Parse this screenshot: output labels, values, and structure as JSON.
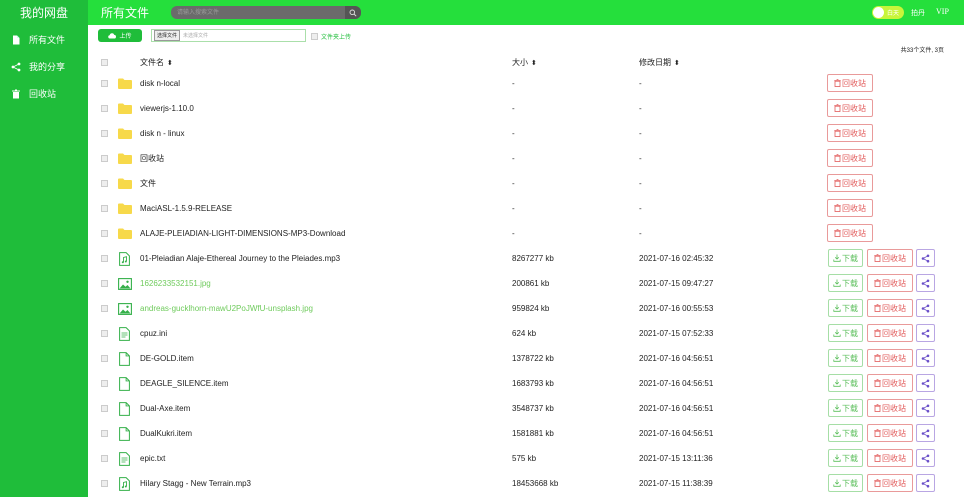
{
  "sidebar": {
    "brand": "我的网盘",
    "items": [
      {
        "label": "所有文件",
        "icon": "file-icon"
      },
      {
        "label": "我的分享",
        "icon": "share-icon"
      },
      {
        "label": "回收站",
        "icon": "trash-icon"
      }
    ]
  },
  "header": {
    "title": "所有文件",
    "search_placeholder": "请输入搜索文件",
    "toggle_label": "白天",
    "link_1": "拍丹",
    "link_2": "VIP"
  },
  "toolbar": {
    "upload_label": "上传",
    "choose_file": "选择文件",
    "no_file": "未选择文件",
    "folder_upload": "文件夹上传",
    "summary": "共33个文件, 3页"
  },
  "table": {
    "col_name": "文件名",
    "col_size": "大小",
    "col_date": "修改日期",
    "action_download": "下载",
    "action_recycle": "回收站",
    "rows": [
      {
        "name": "disk n-local",
        "type": "folder",
        "size": "-",
        "date": "-"
      },
      {
        "name": "viewerjs-1.10.0",
        "type": "folder",
        "size": "-",
        "date": "-"
      },
      {
        "name": "disk n - linux",
        "type": "folder",
        "size": "-",
        "date": "-"
      },
      {
        "name": "回收站",
        "type": "folder",
        "size": "-",
        "date": "-"
      },
      {
        "name": "文件",
        "type": "folder",
        "size": "-",
        "date": "-"
      },
      {
        "name": "MaciASL-1.5.9-RELEASE",
        "type": "folder",
        "size": "-",
        "date": "-"
      },
      {
        "name": "ALAJE-PLEIADIAN-LIGHT-DIMENSIONS-MP3-Download",
        "type": "folder",
        "size": "-",
        "date": "-"
      },
      {
        "name": "01-Pleiadian Alaje-Ethereal Journey to the Pleiades.mp3",
        "type": "audio",
        "size": "8267277 kb",
        "date": "2021-07-16 02:45:32"
      },
      {
        "name": "1626233532151.jpg",
        "type": "image",
        "size": "200861 kb",
        "date": "2021-07-15 09:47:27"
      },
      {
        "name": "andreas-gucklhorn-mawU2PoJWfU-unsplash.jpg",
        "type": "image",
        "size": "959824 kb",
        "date": "2021-07-16 00:55:53"
      },
      {
        "name": "cpuz.ini",
        "type": "doc",
        "size": "624 kb",
        "date": "2021-07-15 07:52:33"
      },
      {
        "name": "DE-GOLD.item",
        "type": "file",
        "size": "1378722 kb",
        "date": "2021-07-16 04:56:51"
      },
      {
        "name": "DEAGLE_SILENCE.item",
        "type": "file",
        "size": "1683793 kb",
        "date": "2021-07-16 04:56:51"
      },
      {
        "name": "Dual-Axe.item",
        "type": "file",
        "size": "3548737 kb",
        "date": "2021-07-16 04:56:51"
      },
      {
        "name": "DualKukri.item",
        "type": "file",
        "size": "1581881 kb",
        "date": "2021-07-16 04:56:51"
      },
      {
        "name": "epic.txt",
        "type": "doc",
        "size": "575 kb",
        "date": "2021-07-15 13:11:36"
      },
      {
        "name": "Hilary Stagg - New Terrain.mp3",
        "type": "audio",
        "size": "18453668 kb",
        "date": "2021-07-15 11:38:39"
      }
    ]
  },
  "colors": {
    "accent": "#1fbd3a",
    "header": "#25df3c",
    "folder": "#f7d94a",
    "danger": "#e25b5b",
    "share": "#6a4fc9"
  }
}
